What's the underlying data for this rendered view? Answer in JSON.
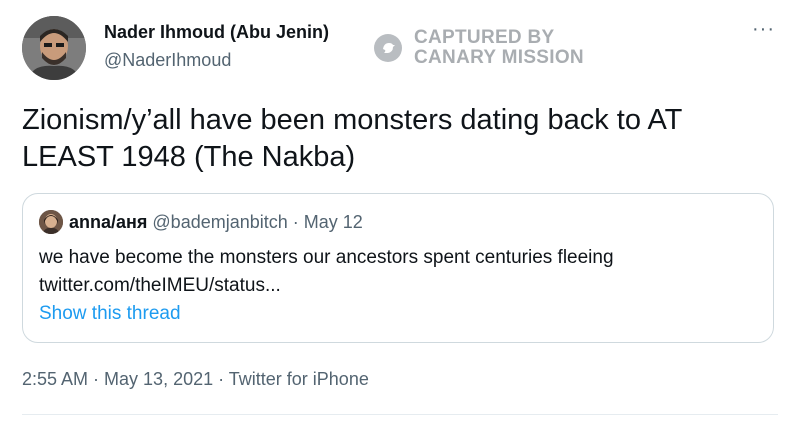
{
  "author": {
    "name": "Nader Ihmoud (Abu Jenin)",
    "handle": "@NaderIhmoud"
  },
  "watermark": {
    "line1": "CAPTURED BY",
    "line2": "CANARY MISSION"
  },
  "more_label": "···",
  "tweet": {
    "text": "Zionism/y’all have been monsters dating back to AT LEAST 1948 (The Nakba)"
  },
  "quote": {
    "name": "anna/аня",
    "handle_date": "@bademjanbitch · May 12",
    "line1": "we have become the monsters our ancestors spent centuries fleeing",
    "line2": "twitter.com/theIMEU/status...",
    "thread_link": "Show this thread"
  },
  "footer": {
    "meta": "2:55 AM · May 13, 2021 · Twitter for iPhone"
  }
}
